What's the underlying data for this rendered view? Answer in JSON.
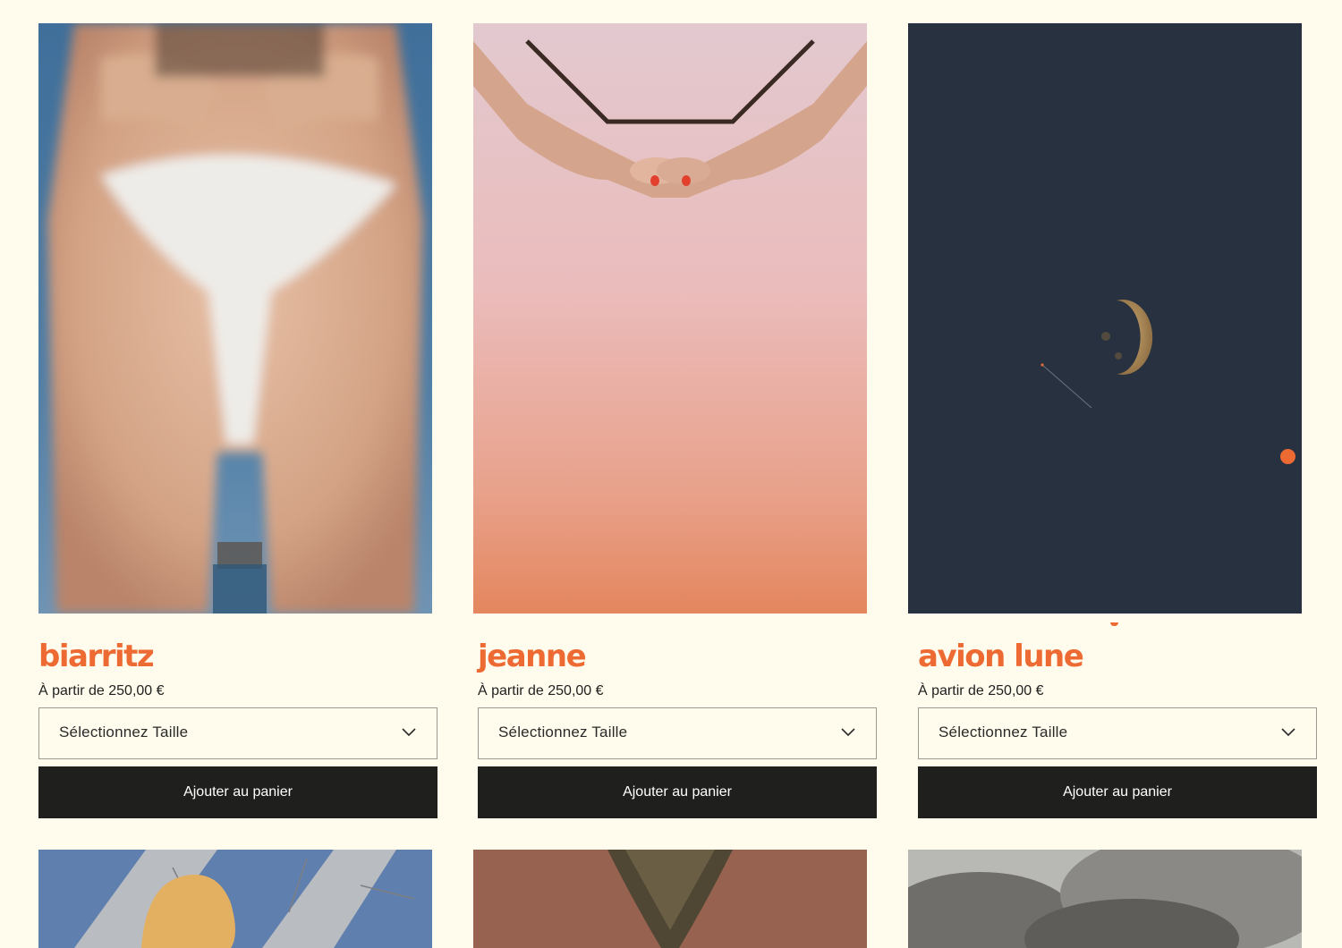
{
  "theme": {
    "background": "#fffcee",
    "accent": "#ee6a33",
    "button_bg": "#1f1f1d",
    "button_text": "#ffffff"
  },
  "products": [
    {
      "title": "biarritz",
      "price": "À partir de 250,00 €",
      "select_label": "Sélectionnez Taille",
      "button_label": "Ajouter au panier",
      "image_icon": "photo-biarritz"
    },
    {
      "title": "jeanne",
      "price": "À partir de 250,00 €",
      "select_label": "Sélectionnez Taille",
      "button_label": "Ajouter au panier",
      "image_icon": "photo-jeanne"
    },
    {
      "title": "avion lune",
      "price": "À partir de 250,00 €",
      "select_label": "Sélectionnez Taille",
      "button_label": "Ajouter au panier",
      "image_icon": "photo-avion-lune"
    }
  ],
  "next_row": [
    {
      "image_icon": "photo-next-1"
    },
    {
      "image_icon": "photo-next-2"
    },
    {
      "image_icon": "photo-next-3"
    }
  ]
}
